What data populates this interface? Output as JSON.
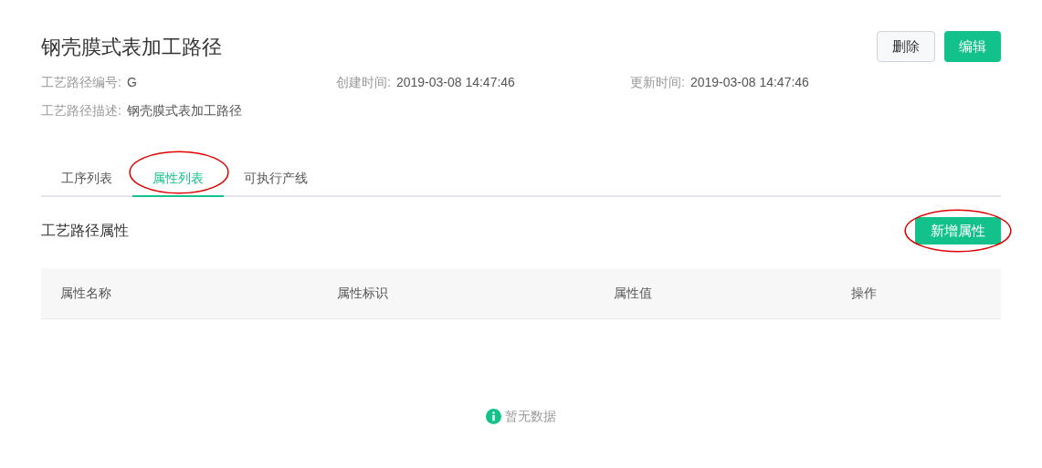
{
  "header": {
    "title": "钢壳膜式表加工路径",
    "buttons": [
      {
        "label": "删除",
        "kind": "default"
      },
      {
        "label": "编辑",
        "kind": "primary"
      }
    ]
  },
  "info": [
    {
      "label": "工艺路径编号:",
      "value": "G"
    },
    {
      "label": "创建时间:",
      "value": "2019-03-08 14:47:46"
    },
    {
      "label": "更新时间:",
      "value": "2019-03-08 14:47:46"
    },
    {
      "label": "工艺路径描述:",
      "value": "钢壳膜式表加工路径"
    }
  ],
  "tabs": [
    {
      "label": "工序列表",
      "selected": false,
      "circled": false
    },
    {
      "label": "属性列表",
      "selected": true,
      "circled": true
    },
    {
      "label": "可执行产线",
      "selected": false,
      "circled": false
    }
  ],
  "section": {
    "title": "工艺路径属性",
    "add_button": {
      "label": "新增属性",
      "circled": true
    }
  },
  "table": {
    "columns": [
      "属性名称",
      "属性标识",
      "属性值",
      "操作"
    ],
    "empty_text": "暂无数据"
  }
}
